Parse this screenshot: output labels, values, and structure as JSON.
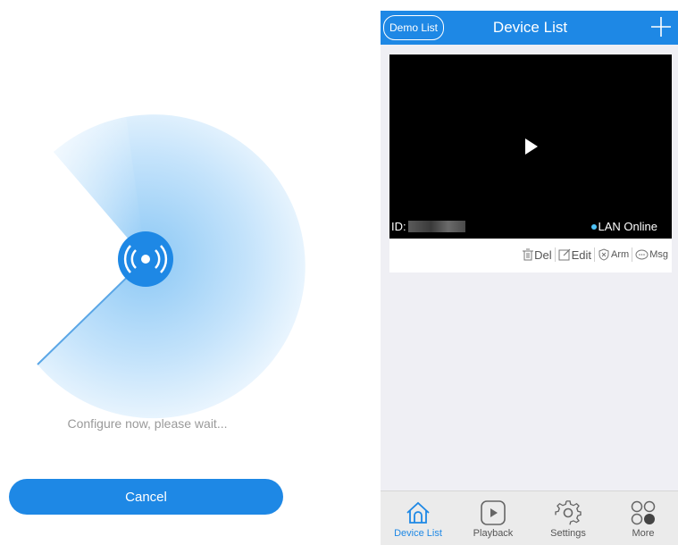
{
  "configure": {
    "status_text": "Configure now, please wait...",
    "cancel_label": "Cancel"
  },
  "device_list": {
    "demo_button_label": "Demo List",
    "title": "Device List",
    "device": {
      "id_label": "ID:",
      "status": "LAN Online"
    },
    "actions": {
      "del": "Del",
      "edit": "Edit",
      "arm": "Arm",
      "msg": "Msg"
    },
    "tabs": [
      {
        "label": "Device List",
        "icon": "home-icon"
      },
      {
        "label": "Playback",
        "icon": "playback-icon"
      },
      {
        "label": "Settings",
        "icon": "settings-icon"
      },
      {
        "label": "More",
        "icon": "more-icon"
      }
    ]
  },
  "colors": {
    "accent": "#1e88e5",
    "online": "#4fc3f7"
  }
}
